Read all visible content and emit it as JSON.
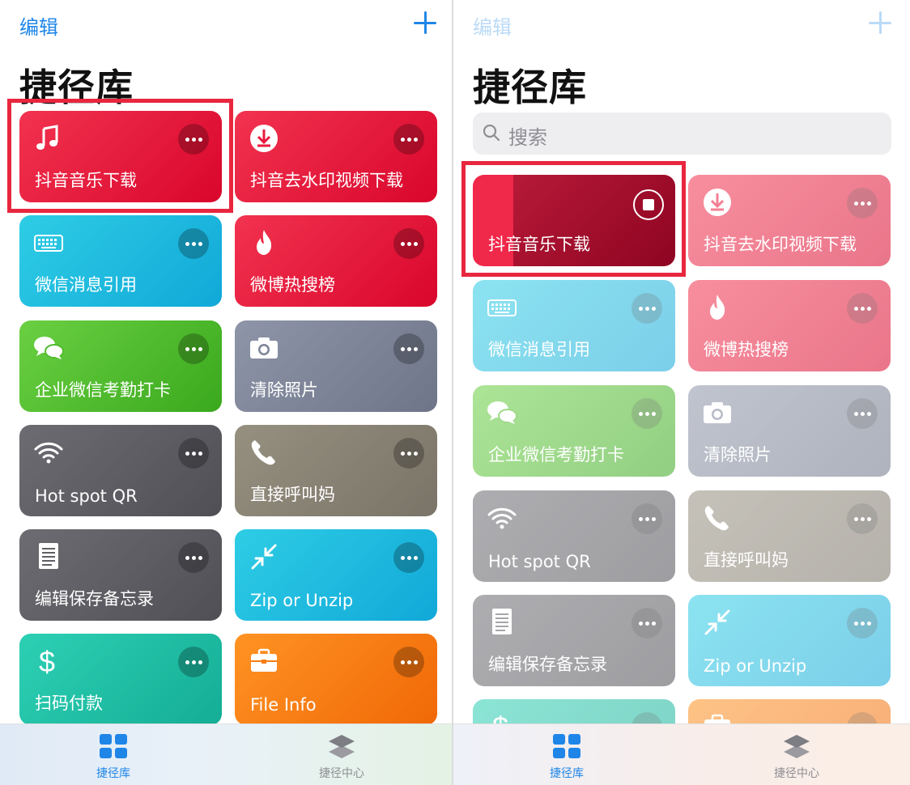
{
  "left": {
    "nav": {
      "edit_label": "编辑"
    },
    "title": "捷径库",
    "tiles": [
      {
        "label": "抖音音乐下载",
        "icon": "music-note-icon"
      },
      {
        "label": "抖音去水印视频下载",
        "icon": "download-icon"
      },
      {
        "label": "微信消息引用",
        "icon": "keyboard-icon"
      },
      {
        "label": "微博热搜榜",
        "icon": "flame-icon"
      },
      {
        "label": "企业微信考勤打卡",
        "icon": "chat-bubbles-icon"
      },
      {
        "label": "清除照片",
        "icon": "camera-icon"
      },
      {
        "label": "Hot spot QR",
        "icon": "wifi-icon"
      },
      {
        "label": "直接呼叫妈",
        "icon": "phone-icon"
      },
      {
        "label": "编辑保存备忘录",
        "icon": "document-icon"
      },
      {
        "label": "Zip or Unzip",
        "icon": "compress-arrows-icon"
      },
      {
        "label": "扫码付款",
        "icon": "dollar-icon"
      },
      {
        "label": "File Info",
        "icon": "briefcase-icon"
      }
    ],
    "tabbar": {
      "library": "捷径库",
      "gallery": "捷径中心"
    }
  },
  "right": {
    "nav": {
      "edit_label": "编辑"
    },
    "title": "捷径库",
    "search": {
      "placeholder": "搜索"
    },
    "tiles": [
      {
        "label": "抖音音乐下载",
        "icon": "stop-icon"
      },
      {
        "label": "抖音去水印视频下载",
        "icon": "download-icon"
      },
      {
        "label": "微信消息引用",
        "icon": "keyboard-icon"
      },
      {
        "label": "微博热搜榜",
        "icon": "flame-icon"
      },
      {
        "label": "企业微信考勤打卡",
        "icon": "chat-bubbles-icon"
      },
      {
        "label": "清除照片",
        "icon": "camera-icon"
      },
      {
        "label": "Hot spot QR",
        "icon": "wifi-icon"
      },
      {
        "label": "直接呼叫妈",
        "icon": "phone-icon"
      },
      {
        "label": "编辑保存备忘录",
        "icon": "document-icon"
      },
      {
        "label": "Zip or Unzip",
        "icon": "compress-arrows-icon"
      }
    ],
    "tabbar": {
      "library": "捷径库",
      "gallery": "捷径中心"
    }
  },
  "colors": {
    "accent": "#1f86e8",
    "highlight": "#e8273f",
    "red": "#e81a3d",
    "cyan": "#1fbbdf",
    "green": "#52bc2f",
    "slate": "#7e8598",
    "gray": "#5f5f65",
    "khaki": "#888274",
    "teal": "#20bfa4",
    "orange": "#f77d15"
  }
}
